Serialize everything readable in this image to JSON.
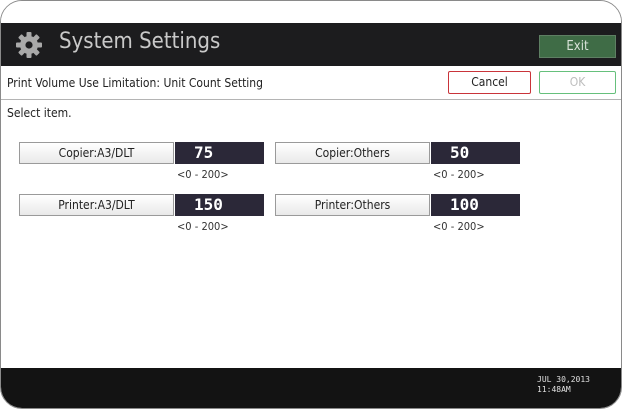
{
  "header": {
    "title": "System Settings",
    "exit_label": "Exit"
  },
  "subheader": {
    "title": "Print Volume Use Limitation: Unit Count Setting",
    "cancel_label": "Cancel",
    "ok_label": "OK"
  },
  "instruction": "Select item.",
  "settings": [
    {
      "label": "Copier:A3/DLT",
      "value": "75",
      "range": "<0 - 200>"
    },
    {
      "label": "Copier:Others",
      "value": "50",
      "range": "<0 - 200>"
    },
    {
      "label": "Printer:A3/DLT",
      "value": "150",
      "range": "<0 - 200>"
    },
    {
      "label": "Printer:Others",
      "value": "100",
      "range": "<0 - 200>"
    }
  ],
  "footer": {
    "date": "JUL  30,2013",
    "time": "11:48AM"
  },
  "colors": {
    "titlebar": "#1c1c1e",
    "exit_button": "#3f6c46",
    "cancel_border": "#c9343a",
    "ok_border": "#66c07c",
    "value_box": "#2b2838"
  },
  "icons": {
    "header": "gear-icon"
  }
}
